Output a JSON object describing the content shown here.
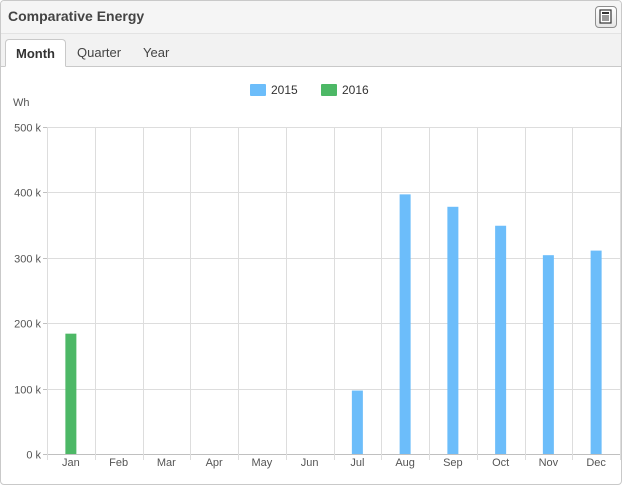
{
  "header": {
    "title": "Comparative Energy",
    "export_icon": "export-document-icon"
  },
  "tabs": [
    {
      "label": "Month",
      "active": true
    },
    {
      "label": "Quarter",
      "active": false
    },
    {
      "label": "Year",
      "active": false
    }
  ],
  "chart_data": {
    "type": "bar",
    "ylabel": "Wh",
    "ylim": [
      0,
      500000
    ],
    "yticks": [
      0,
      100000,
      200000,
      300000,
      400000,
      500000
    ],
    "ytick_labels": [
      "0 k",
      "100 k",
      "200 k",
      "300 k",
      "400 k",
      "500 k"
    ],
    "categories": [
      "Jan",
      "Feb",
      "Mar",
      "Apr",
      "May",
      "Jun",
      "Jul",
      "Aug",
      "Sep",
      "Oct",
      "Nov",
      "Dec"
    ],
    "grid": true,
    "legend": "top-center",
    "series": [
      {
        "name": "2015",
        "color": "#6cbdfa",
        "values": [
          null,
          null,
          null,
          null,
          null,
          null,
          97000,
          397000,
          378000,
          349000,
          304000,
          311000
        ]
      },
      {
        "name": "2016",
        "color": "#4db866",
        "values": [
          184000,
          null,
          null,
          null,
          null,
          null,
          null,
          null,
          null,
          null,
          null,
          null
        ]
      }
    ]
  }
}
